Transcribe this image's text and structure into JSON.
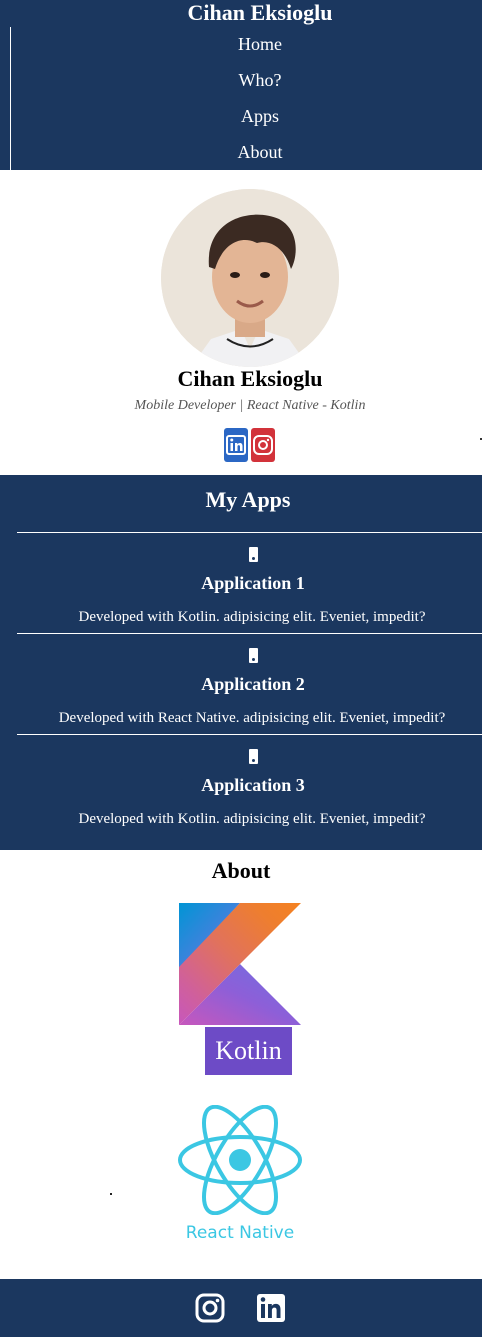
{
  "header": {
    "brand": "Cihan Eksioglu",
    "nav": [
      "Home",
      "Who?",
      "Apps",
      "About"
    ]
  },
  "profile": {
    "name": "Cihan Eksioglu",
    "title": "Mobile Developer | React Native - Kotlin",
    "social_icons": [
      "linkedin-icon",
      "instagram-icon"
    ]
  },
  "apps": {
    "title": "My Apps",
    "items": [
      {
        "name": "Application 1",
        "desc": "Developed with Kotlin. adipisicing elit. Eveniet, impedit?"
      },
      {
        "name": "Application 2",
        "desc": "Developed with React Native. adipisicing elit. Eveniet, impedit?"
      },
      {
        "name": "Application 3",
        "desc": "Developed with Kotlin. adipisicing elit. Eveniet, impedit?"
      }
    ]
  },
  "about": {
    "title": "About",
    "kotlin_label": "Kotlin",
    "react_label": "React Native"
  },
  "footer": {
    "icons": [
      "instagram-icon",
      "linkedin-icon"
    ]
  },
  "colors": {
    "navy": "#1b375f",
    "kotlin_purple": "#6d4bc6",
    "react_cyan": "#3bc7e3"
  }
}
